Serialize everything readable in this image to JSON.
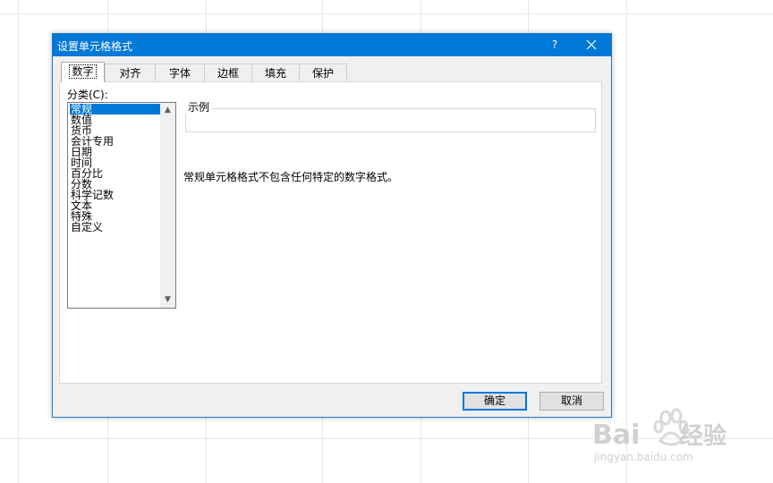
{
  "dialog": {
    "title": "设置单元格格式",
    "help_label": "?",
    "close_icon": "close-icon"
  },
  "tabs": [
    {
      "label": "数字",
      "active": true
    },
    {
      "label": "对齐"
    },
    {
      "label": "字体"
    },
    {
      "label": "边框"
    },
    {
      "label": "填充"
    },
    {
      "label": "保护"
    }
  ],
  "category": {
    "label": "分类(C):",
    "items": [
      "常规",
      "数值",
      "货币",
      "会计专用",
      "日期",
      "时间",
      "百分比",
      "分数",
      "科学记数",
      "文本",
      "特殊",
      "自定义"
    ],
    "selected": "常规"
  },
  "sample": {
    "legend": "示例",
    "value": ""
  },
  "description": "常规单元格格式不包含任何特定的数字格式。",
  "buttons": {
    "ok": "确定",
    "cancel": "取消"
  },
  "watermark": {
    "brand": "Bai du 经验",
    "url": "jingyan.baidu.com"
  },
  "colors": {
    "titlebar": "#0078d7",
    "selection": "#0078d7",
    "dialog_bg": "#f0f0f0"
  }
}
